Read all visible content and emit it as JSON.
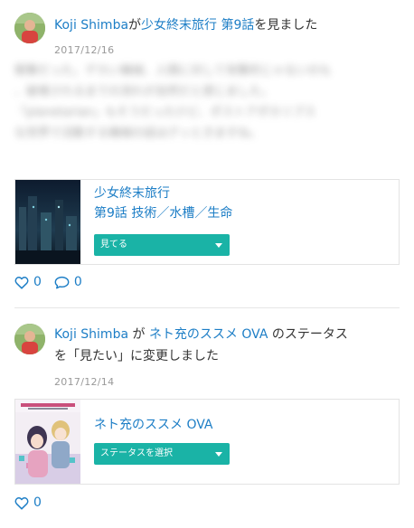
{
  "activities": [
    {
      "user": "Koji Shimba",
      "connector": "が",
      "work": "少女終末旅行 第9話",
      "suffix": "を見ました",
      "date": "2017/12/16",
      "comment_lines": [
        "衝撃だった。デカい機械、人間に対して攻撃的じゃないのも",
        "、破壊されるまでの流れが自然だと感じました。",
        "「planetarian」もそうだったけど、ポストアポカリプス",
        "な世界で活動する機械の話はグッときますね。"
      ],
      "card": {
        "title_line1": "少女終末旅行",
        "title_line2": "第9話  技術／水槽／生命",
        "status": "見てる"
      },
      "likes": "0",
      "comments": "0"
    },
    {
      "user": "Koji Shimba",
      "connector": " が",
      "work": "ネト充のススメ OVA",
      "suffix_line1": " のステータス",
      "suffix_line2": "を「見たい」に変更しました",
      "date": "2017/12/14",
      "card": {
        "title_line1": "ネト充のススメ OVA",
        "status": "ステータスを選択"
      },
      "likes": "0"
    }
  ],
  "icons": {
    "like": "heart-outline-icon",
    "comment": "speech-bubble-outline-icon",
    "select_caret": "caret-down-icon"
  },
  "colors": {
    "link": "#1d7ec6",
    "status_button": "#1ab3a6",
    "date": "#999999"
  }
}
